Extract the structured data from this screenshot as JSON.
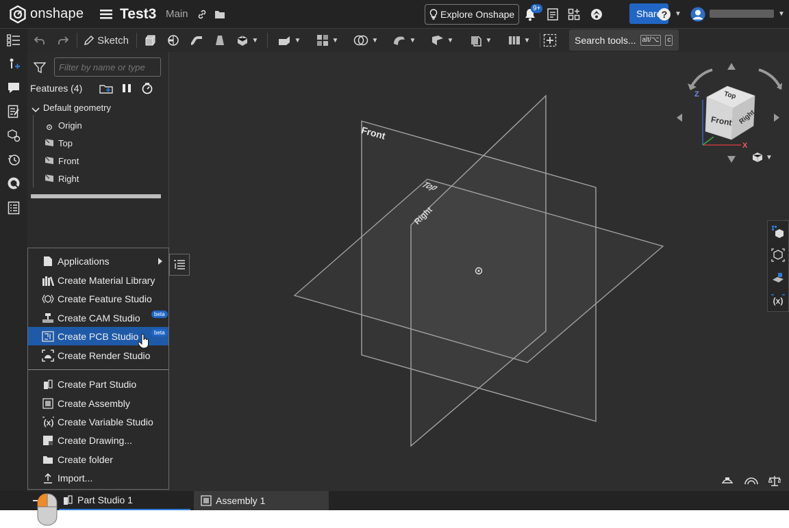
{
  "app": {
    "brand": "onshape"
  },
  "document": {
    "title": "Test3",
    "branch": "Main"
  },
  "header": {
    "explore_label": "Explore Onshape",
    "notification_count": "9+",
    "share_label": "Share",
    "help_icon": "question-icon"
  },
  "toolbar": {
    "sketch_label": "Sketch",
    "search_label": "Search tools...",
    "search_shortcut_mod": "alt/⌥",
    "search_shortcut_key": "c"
  },
  "feature_panel": {
    "filter_placeholder": "Filter by name or type",
    "features_header": "Features (4)",
    "group_label": "Default geometry",
    "items": [
      {
        "label": "Origin",
        "icon": "origin-icon"
      },
      {
        "label": "Top",
        "icon": "plane-icon"
      },
      {
        "label": "Front",
        "icon": "plane-icon"
      },
      {
        "label": "Right",
        "icon": "plane-icon"
      }
    ]
  },
  "viewport": {
    "plane_labels": {
      "front": "Front",
      "top": "Top",
      "right": "Right"
    },
    "view_cube": {
      "top": "Top",
      "front": "Front",
      "right": "Right",
      "axis_z": "Z",
      "axis_x": "X"
    }
  },
  "context_menu": {
    "items": [
      {
        "label": "Applications",
        "icon": "document-icon",
        "submenu": true
      },
      {
        "label": "Create Material Library",
        "icon": "material-library-icon"
      },
      {
        "label": "Create Feature Studio",
        "icon": "feature-studio-icon"
      },
      {
        "label": "Create CAM Studio",
        "icon": "cam-studio-icon",
        "badge": "beta"
      },
      {
        "label": "Create PCB Studio",
        "icon": "pcb-studio-icon",
        "badge": "beta",
        "selected": true
      },
      {
        "label": "Create Render Studio",
        "icon": "render-studio-icon"
      },
      {
        "label": "Create Part Studio",
        "icon": "part-studio-icon"
      },
      {
        "label": "Create Assembly",
        "icon": "assembly-icon"
      },
      {
        "label": "Create Variable Studio",
        "icon": "variable-studio-icon"
      },
      {
        "label": "Create Drawing...",
        "icon": "drawing-icon"
      },
      {
        "label": "Create folder",
        "icon": "folder-icon"
      },
      {
        "label": "Import...",
        "icon": "import-icon"
      }
    ]
  },
  "tabs": [
    {
      "label": "Part Studio 1",
      "active": true
    },
    {
      "label": "Assembly 1",
      "active": false
    }
  ],
  "colors": {
    "accent": "#2166c4",
    "selected": "#1f5aa8",
    "background": "#2e2e2e"
  }
}
